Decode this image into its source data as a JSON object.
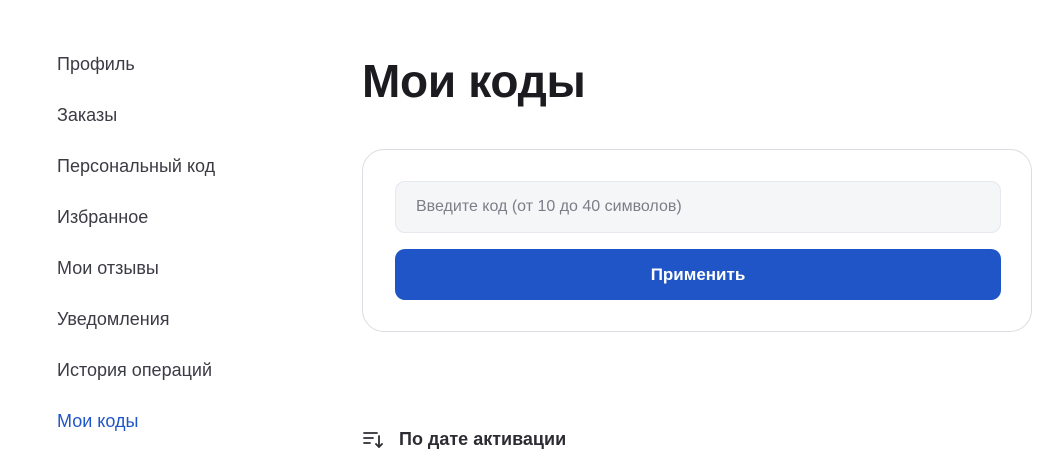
{
  "sidebar": {
    "items": [
      {
        "label": "Профиль"
      },
      {
        "label": "Заказы"
      },
      {
        "label": "Персональный код"
      },
      {
        "label": "Избранное"
      },
      {
        "label": "Мои отзывы"
      },
      {
        "label": "Уведомления"
      },
      {
        "label": "История операций"
      },
      {
        "label": "Мои коды",
        "active": true
      }
    ]
  },
  "main": {
    "title": "Мои коды",
    "code_input": {
      "value": "",
      "placeholder": "Введите код (от 10 до 40 символов)"
    },
    "apply_label": "Применить",
    "sort": {
      "label": "По дате активации",
      "icon": "sort-icon"
    }
  },
  "colors": {
    "accent": "#1f55c6",
    "text": "#1b1b20",
    "input_bg": "#f5f6f8",
    "card_border": "#dcdde3"
  }
}
